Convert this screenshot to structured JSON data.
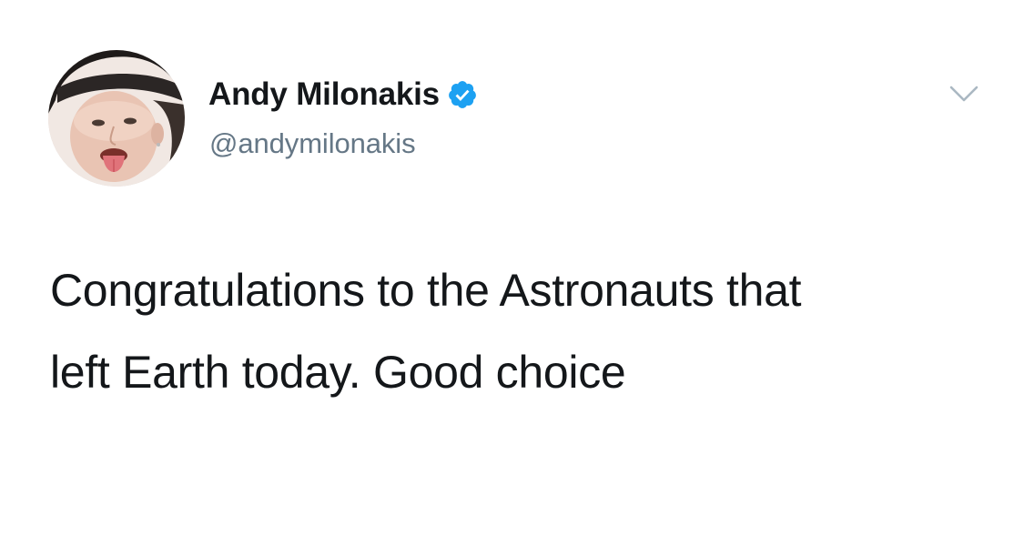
{
  "tweet": {
    "author": {
      "name": "Andy Milonakis",
      "handle": "@andymilonakis",
      "verified": true,
      "avatar_icon": "user-avatar-photo"
    },
    "text_lines": [
      "Congratulations to the Astronauts that",
      "left Earth today. Good choice"
    ],
    "menu_icon": "chevron-down-icon"
  },
  "colors": {
    "verified_blue": "#1DA1F2",
    "handle_gray": "#657786",
    "chevron_gray": "#AAB8C2",
    "text_dark": "#14171A",
    "background": "#FFFFFF"
  }
}
